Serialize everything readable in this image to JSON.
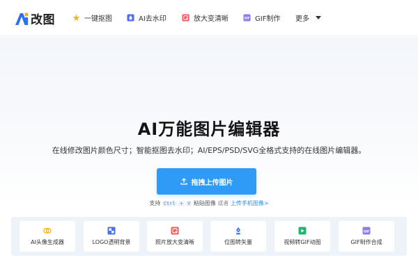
{
  "header": {
    "logo_text": "改图",
    "nav": [
      {
        "label": "一键抠图",
        "icon": "star-sparkle-icon"
      },
      {
        "label": "AI去水印",
        "icon": "droplet-icon"
      },
      {
        "label": "放大变清晰",
        "icon": "enlarge-image-icon"
      },
      {
        "label": "GIF制作",
        "icon": "gif-icon"
      }
    ],
    "more_label": "更多"
  },
  "hero": {
    "title": "AI万能图片编辑器",
    "subtitle": "在线修改图片颜色尺寸；智能抠图去水印；AI/EPS/PSD/SVG全格式支持的在线图片编辑器。",
    "upload_label": "拖拽上传图片",
    "hint": {
      "prefix": "支持",
      "key1": "Ctrl",
      "plus": "+",
      "key2": "V",
      "paste": "粘贴图像",
      "or": "或者",
      "mobile_link": "上传手机图像>"
    }
  },
  "features": [
    {
      "label": "AI头像生成器",
      "icon": "avatar-generator-icon"
    },
    {
      "label": "LOGO透明背景",
      "icon": "transparent-grid-icon"
    },
    {
      "label": "照片放大变清晰",
      "icon": "photo-enlarge-icon"
    },
    {
      "label": "位图转矢量",
      "icon": "vector-pen-icon"
    },
    {
      "label": "视频转GIF动图",
      "icon": "video-gif-icon"
    },
    {
      "label": "GIF制作合成",
      "icon": "gif-icon"
    }
  ],
  "colors": {
    "primary": "#2f9bf7",
    "logo_blue": "#2f6ff5",
    "logo_orange": "#f5a623"
  }
}
